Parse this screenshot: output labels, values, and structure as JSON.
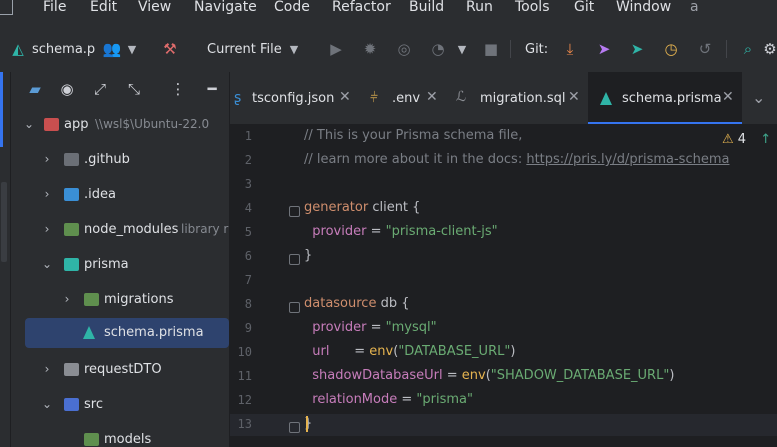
{
  "menu": [
    "File",
    "Edit",
    "View",
    "Navigate",
    "Code",
    "Refactor",
    "Build",
    "Run",
    "Tools",
    "Git",
    "Window",
    "a"
  ],
  "toolbar": {
    "project_name": "schema.p",
    "run_config": "Current File",
    "git_label": "Git:"
  },
  "project_tree": [
    {
      "label": "app",
      "sub": "\\\\wsl$\\Ubuntu-22.0",
      "depth": 0,
      "expanded": true,
      "icon": "folder-app"
    },
    {
      "label": ".github",
      "depth": 1,
      "expanded": false,
      "icon": "github-folder"
    },
    {
      "label": ".idea",
      "depth": 1,
      "expanded": false,
      "icon": "idea-folder"
    },
    {
      "label": "node_modules",
      "sub": "library r",
      "depth": 1,
      "expanded": false,
      "icon": "node-folder"
    },
    {
      "label": "prisma",
      "depth": 1,
      "expanded": true,
      "icon": "prisma-folder"
    },
    {
      "label": "migrations",
      "depth": 2,
      "expanded": false,
      "icon": "db-folder"
    },
    {
      "label": "schema.prisma",
      "depth": 2,
      "selected": true,
      "icon": "prisma-file"
    },
    {
      "label": "requestDTO",
      "depth": 1,
      "expanded": false,
      "icon": "folder"
    },
    {
      "label": "src",
      "depth": 1,
      "expanded": true,
      "icon": "src-folder"
    },
    {
      "label": "models",
      "depth": 2,
      "icon": "models-folder"
    }
  ],
  "tabs": [
    {
      "label": "tsconfig.json",
      "icon": "ts-icon"
    },
    {
      "label": ".env",
      "icon": "env-icon"
    },
    {
      "label": "migration.sql",
      "icon": "sql-icon"
    },
    {
      "label": "schema.prisma",
      "icon": "prisma-icon",
      "active": true
    }
  ],
  "editor": {
    "warnings": "4",
    "lines": [
      [
        [
          "comment",
          "// This is your Prisma schema file,"
        ]
      ],
      [
        [
          "comment",
          "// learn more about it in the docs: "
        ],
        [
          "link",
          "https://pris.ly/d/prisma-schema"
        ]
      ],
      [],
      [
        [
          "kw",
          "generator "
        ],
        [
          "plain",
          "client {"
        ]
      ],
      [
        [
          "plain",
          "  "
        ],
        [
          "prop",
          "provider"
        ],
        [
          "plain",
          " = "
        ],
        [
          "str",
          "\"prisma-client-js\""
        ]
      ],
      [
        [
          "plain",
          "}"
        ]
      ],
      [],
      [
        [
          "kw",
          "datasource "
        ],
        [
          "plain",
          "db {"
        ]
      ],
      [
        [
          "plain",
          "  "
        ],
        [
          "prop",
          "provider"
        ],
        [
          "plain",
          " = "
        ],
        [
          "str",
          "\"mysql\""
        ]
      ],
      [
        [
          "plain",
          "  "
        ],
        [
          "prop",
          "url"
        ],
        [
          "plain",
          "      = "
        ],
        [
          "fn",
          "env"
        ],
        [
          "plain",
          "("
        ],
        [
          "str",
          "\"DATABASE_URL\""
        ],
        [
          "plain",
          ")"
        ]
      ],
      [
        [
          "plain",
          "  "
        ],
        [
          "prop",
          "shadowDatabaseUrl"
        ],
        [
          "plain",
          " = "
        ],
        [
          "fn",
          "env"
        ],
        [
          "plain",
          "("
        ],
        [
          "str",
          "\"SHADOW_DATABASE_URL\""
        ],
        [
          "plain",
          ")"
        ]
      ],
      [
        [
          "plain",
          "  "
        ],
        [
          "prop",
          "relationMode"
        ],
        [
          "plain",
          " = "
        ],
        [
          "str",
          "\"prisma\""
        ]
      ],
      [
        [
          "plain",
          "}"
        ]
      ]
    ]
  },
  "colors": {
    "accent": "#3574f0",
    "selection": "#2e436e",
    "prisma": "#2fb4a7"
  }
}
